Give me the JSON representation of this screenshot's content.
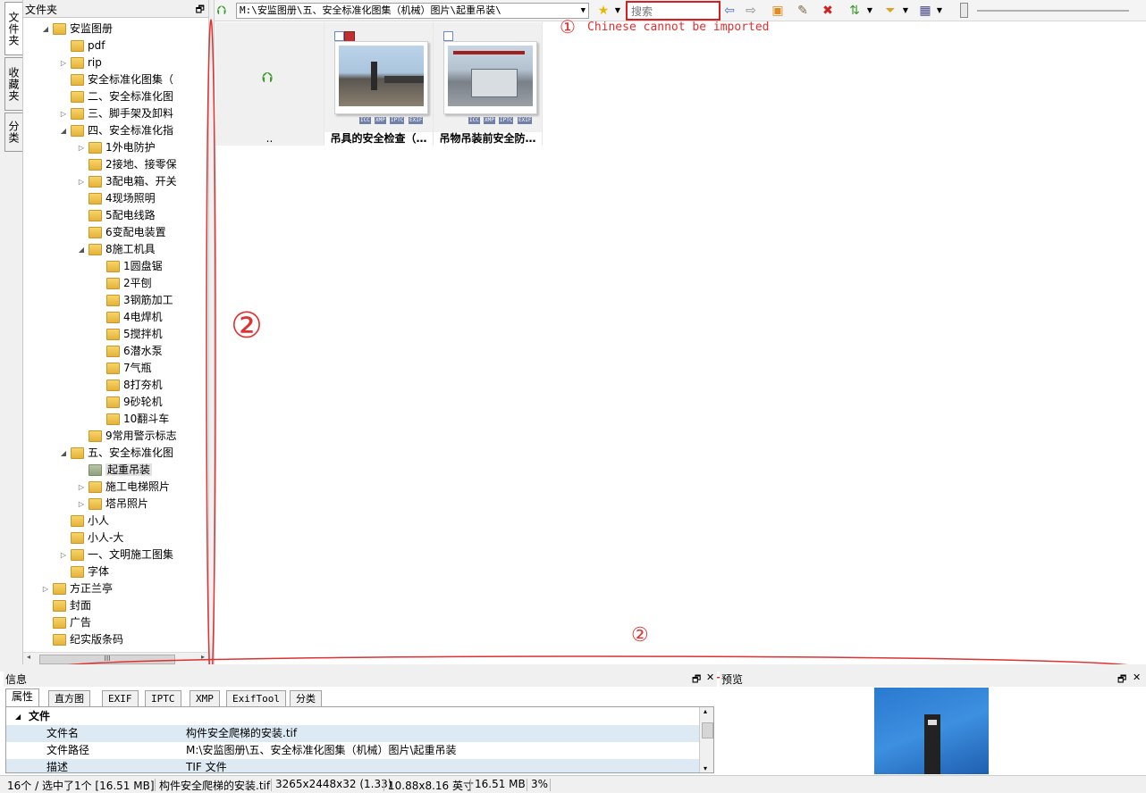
{
  "vertical_tabs": [
    "文件夹",
    "收藏夹",
    "分类"
  ],
  "folder_panel": {
    "title": "文件夹"
  },
  "tree": [
    {
      "label": "安监图册",
      "toggle": "◢",
      "y": 0
    },
    {
      "label": "pdf",
      "toggle": "",
      "y": 1
    },
    {
      "label": "rip",
      "toggle": "▷",
      "y": 2
    },
    {
      "label": "安全标准化图集（",
      "toggle": "",
      "y": 3
    },
    {
      "label": "二、安全标准化图",
      "toggle": "",
      "y": 4
    },
    {
      "label": "三、脚手架及卸料",
      "toggle": "▷",
      "y": 5
    },
    {
      "label": "四、安全标准化指",
      "toggle": "◢",
      "y": 6
    },
    {
      "label": "1外电防护",
      "toggle": "▷",
      "y": 7
    },
    {
      "label": "2接地、接零保",
      "toggle": "",
      "y": 8
    },
    {
      "label": "3配电箱、开关",
      "toggle": "▷",
      "y": 9
    },
    {
      "label": "4现场照明",
      "toggle": "",
      "y": 10
    },
    {
      "label": "5配电线路",
      "toggle": "",
      "y": 11
    },
    {
      "label": "6变配电装置",
      "toggle": "",
      "y": 12
    },
    {
      "label": "8施工机具",
      "toggle": "◢",
      "y": 13
    },
    {
      "label": "1圆盘锯",
      "toggle": "",
      "y": 14
    },
    {
      "label": "2平刨",
      "toggle": "",
      "y": 15
    },
    {
      "label": "3钢筋加工",
      "toggle": "",
      "y": 16
    },
    {
      "label": "4电焊机",
      "toggle": "",
      "y": 17
    },
    {
      "label": "5搅拌机",
      "toggle": "",
      "y": 18
    },
    {
      "label": "6潜水泵",
      "toggle": "",
      "y": 19
    },
    {
      "label": "7气瓶",
      "toggle": "",
      "y": 20
    },
    {
      "label": "8打夯机",
      "toggle": "",
      "y": 21
    },
    {
      "label": "9砂轮机",
      "toggle": "",
      "y": 22
    },
    {
      "label": "10翻斗车",
      "toggle": "",
      "y": 23
    },
    {
      "label": "9常用警示标志",
      "toggle": "",
      "y": 24
    },
    {
      "label": "五、安全标准化图",
      "toggle": "◢",
      "y": 25
    },
    {
      "label": "起重吊装",
      "toggle": "",
      "y": 26,
      "selected": true
    },
    {
      "label": "施工电梯照片",
      "toggle": "▷",
      "y": 27
    },
    {
      "label": "塔吊照片",
      "toggle": "▷",
      "y": 28
    },
    {
      "label": "小人",
      "toggle": "",
      "y": 29
    },
    {
      "label": "小人-大",
      "toggle": "",
      "y": 30
    },
    {
      "label": "一、文明施工图集",
      "toggle": "▷",
      "y": 31
    },
    {
      "label": "字体",
      "toggle": "",
      "y": 32
    },
    {
      "label": "方正兰亭",
      "toggle": "▷",
      "y": 33
    },
    {
      "label": "封面",
      "toggle": "",
      "y": 34
    },
    {
      "label": "广告",
      "toggle": "",
      "y": 35
    },
    {
      "label": "纪实版条码",
      "toggle": "",
      "y": 36
    }
  ],
  "toolbar": {
    "address": "M:\\安监图册\\五、安全标准化图集（机械）图片\\起重吊装\\",
    "search_placeholder": "搜索"
  },
  "thumbnails": {
    "parent_label": "..",
    "items": [
      {
        "caption": "吊具的安全检查（…",
        "badges": [
          "ICC",
          "XMP",
          "IPTC",
          "EXIF"
        ]
      },
      {
        "caption": "吊物吊装前安全防…",
        "badges": [
          "ICC",
          "XMP",
          "IPTC",
          "EXIF"
        ]
      }
    ]
  },
  "annotations": {
    "note1_marker": "①",
    "note1": "Chinese cannot be imported",
    "marker2": "②",
    "marker3": "②"
  },
  "info_panel": {
    "title": "信息",
    "tabs": [
      "属性",
      "直方图",
      "EXIF",
      "IPTC",
      "XMP",
      "ExifTool",
      "分类"
    ],
    "section": "文件",
    "rows": [
      {
        "key": "文件名",
        "value": "构件安全爬梯的安装.tif"
      },
      {
        "key": "文件路径",
        "value": "M:\\安监图册\\五、安全标准化图集（机械）图片\\起重吊装"
      },
      {
        "key": "描述",
        "value": "TIF 文件"
      }
    ]
  },
  "preview_panel": {
    "title": "预览"
  },
  "status": {
    "count": "16个 / 选中了1个 [16.51 MB]",
    "filename": "构件安全爬梯的安装.tif",
    "dims": "3265x2448x32 (1.33)",
    "size_in": "10.88x8.16 英寸",
    "filesize": "16.51 MB",
    "zoom": "3%"
  }
}
